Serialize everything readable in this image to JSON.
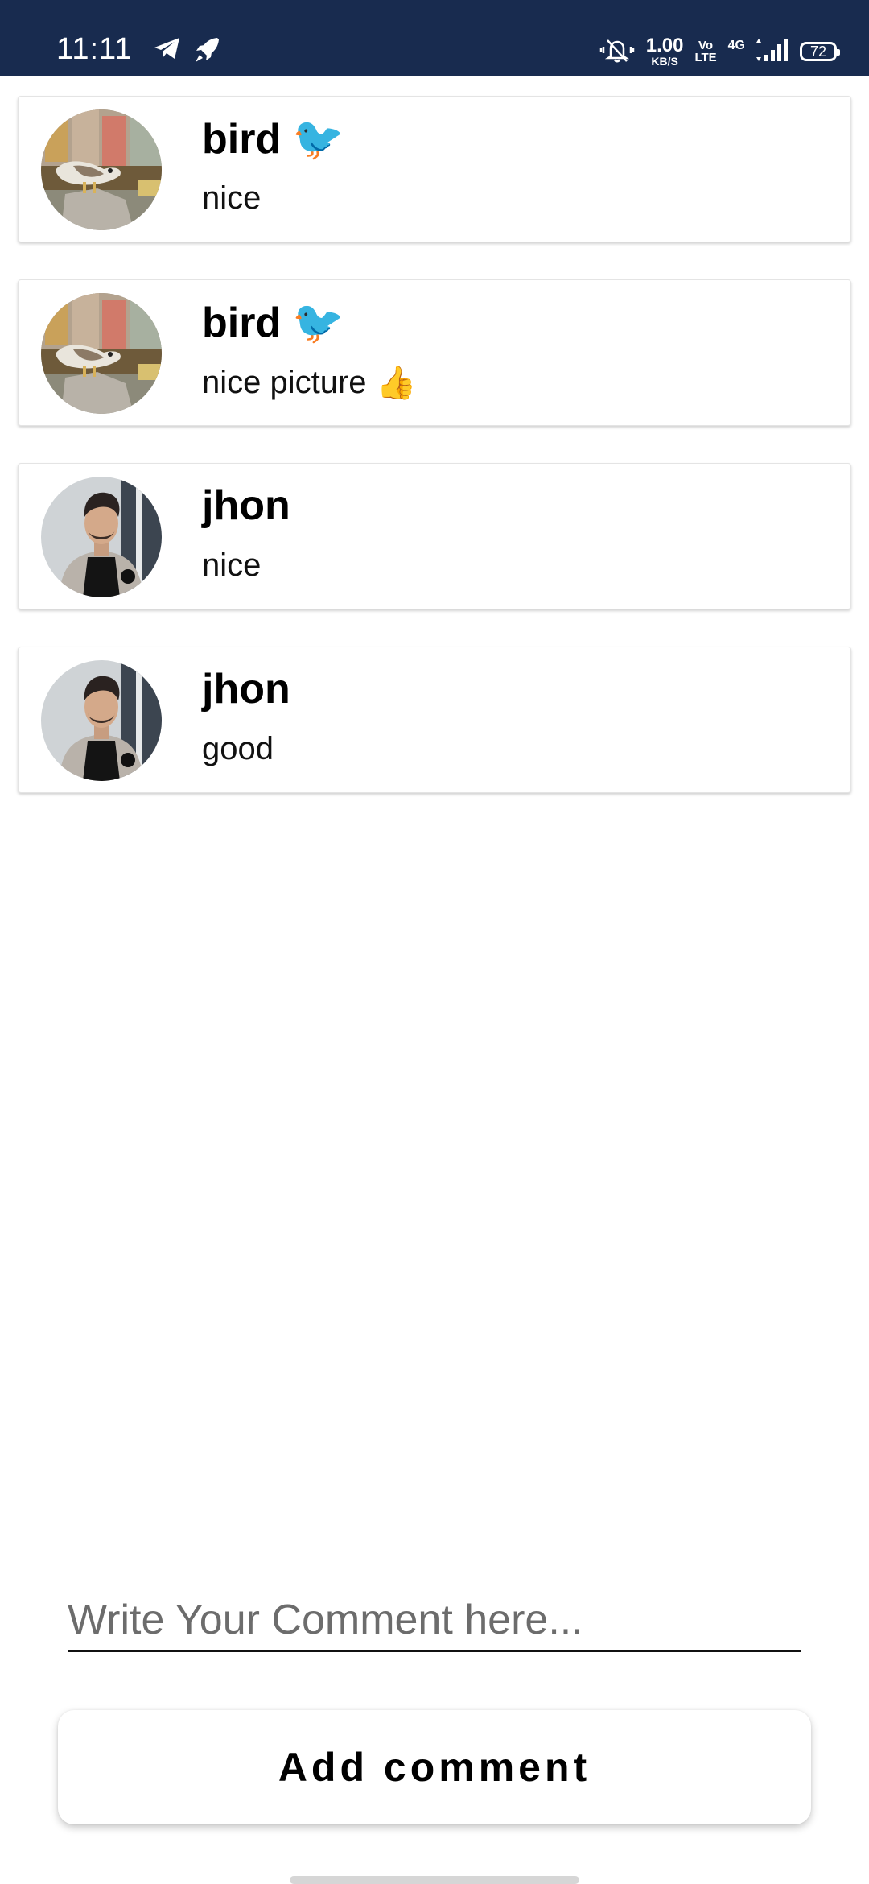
{
  "status_bar": {
    "time": "11:11",
    "speed_value": "1.00",
    "speed_unit": "KB/S",
    "volte_top": "Vo",
    "volte_bottom": "LTE",
    "network": "4G",
    "battery": "72",
    "background": "#182b4f"
  },
  "comments": [
    {
      "author": "bird",
      "author_emoji": "🐦",
      "text": "nice",
      "text_emoji": "",
      "avatar": "bird-photo"
    },
    {
      "author": "bird",
      "author_emoji": "🐦",
      "text": "nice picture",
      "text_emoji": "👍",
      "avatar": "bird-photo"
    },
    {
      "author": "jhon",
      "author_emoji": "",
      "text": "nice",
      "text_emoji": "",
      "avatar": "man-photo"
    },
    {
      "author": "jhon",
      "author_emoji": "",
      "text": "good",
      "text_emoji": "",
      "avatar": "man-photo"
    }
  ],
  "composer": {
    "placeholder": "Write Your Comment here...",
    "value": "",
    "button_label": "Add comment"
  }
}
